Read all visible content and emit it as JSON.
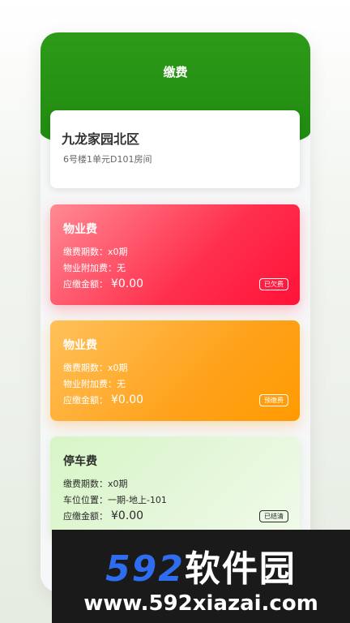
{
  "header": {
    "title": "缴费"
  },
  "address": {
    "estate": "九龙家园北区",
    "room": "6号楼1单元D101房间"
  },
  "fees": [
    {
      "title": "物业费",
      "periods_label": "缴费期数：",
      "periods_value": "x0期",
      "extra_label": "物业附加费：",
      "extra_value": "无",
      "amount_label": "应缴金额：",
      "amount_value": "¥0.00",
      "badge": "已欠费"
    },
    {
      "title": "物业费",
      "periods_label": "缴费期数：",
      "periods_value": "x0期",
      "extra_label": "物业附加费：",
      "extra_value": "无",
      "amount_label": "应缴金额：",
      "amount_value": "¥0.00",
      "badge": "预缴费"
    },
    {
      "title": "停车费",
      "periods_label": "缴费期数：",
      "periods_value": "x0期",
      "extra_label": "车位位置：",
      "extra_value": "一期-地上-101",
      "amount_label": "应缴金额：",
      "amount_value": "¥0.00",
      "badge": "已结清"
    }
  ],
  "watermark": {
    "brand_num": "592",
    "brand_cn": "软件园",
    "url": "www.592xiazai.com"
  },
  "colors": {
    "header_green": "#1f8a10",
    "arrears_red": "#ff2f4d",
    "prepay_orange": "#ffa21c",
    "settled_green": "#d7f5c6"
  }
}
